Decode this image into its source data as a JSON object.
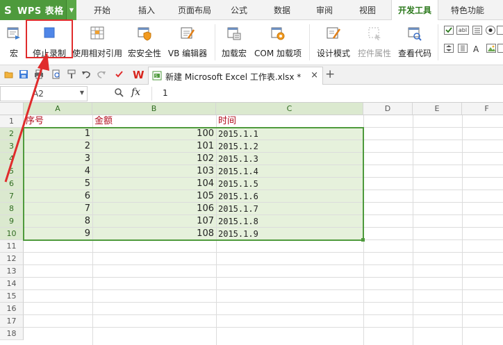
{
  "app": {
    "title": "WPS 表格",
    "logo_letter": "S"
  },
  "menu": {
    "tabs": [
      "开始",
      "插入",
      "页面布局",
      "公式",
      "数据",
      "审阅",
      "视图",
      "开发工具",
      "特色功能"
    ],
    "active": "开发工具"
  },
  "ribbon": {
    "macro": "宏",
    "stop_recording": "停止录制",
    "relative_ref": "使用相对引用",
    "macro_security": "宏安全性",
    "vb_editor": "VB 编辑器",
    "load_macro": "加载宏",
    "com_addins": "COM 加载项",
    "design_mode": "设计模式",
    "control_props": "控件属性",
    "view_code": "查看代码"
  },
  "document": {
    "tab_name": "新建 Microsoft Excel 工作表.xlsx *",
    "close": "×",
    "new_tab": "+"
  },
  "formula_bar": {
    "name_box": "A2",
    "fx": "fx",
    "value": "1"
  },
  "sheet": {
    "columns": [
      "A",
      "B",
      "C",
      "D",
      "E",
      "F"
    ],
    "rows": [
      "1",
      "2",
      "3",
      "4",
      "5",
      "6",
      "7",
      "8",
      "9",
      "10",
      "11",
      "12",
      "13",
      "14",
      "15",
      "16",
      "17",
      "18"
    ],
    "headers": [
      "序号",
      "金额",
      "时间"
    ],
    "data": [
      [
        "1",
        "100",
        "2015.1.1"
      ],
      [
        "2",
        "101",
        "2015.1.2"
      ],
      [
        "3",
        "102",
        "2015.1.3"
      ],
      [
        "4",
        "103",
        "2015.1.4"
      ],
      [
        "5",
        "104",
        "2015.1.5"
      ],
      [
        "6",
        "105",
        "2015.1.6"
      ],
      [
        "7",
        "106",
        "2015.1.7"
      ],
      [
        "8",
        "107",
        "2015.1.8"
      ],
      [
        "9",
        "108",
        "2015.1.9"
      ]
    ]
  },
  "colors": {
    "brand_green": "#4e9a3c",
    "selection_fill": "#e6f1dc",
    "header_text_red": "#b10c1c",
    "annotation_red": "#e02b2b"
  }
}
